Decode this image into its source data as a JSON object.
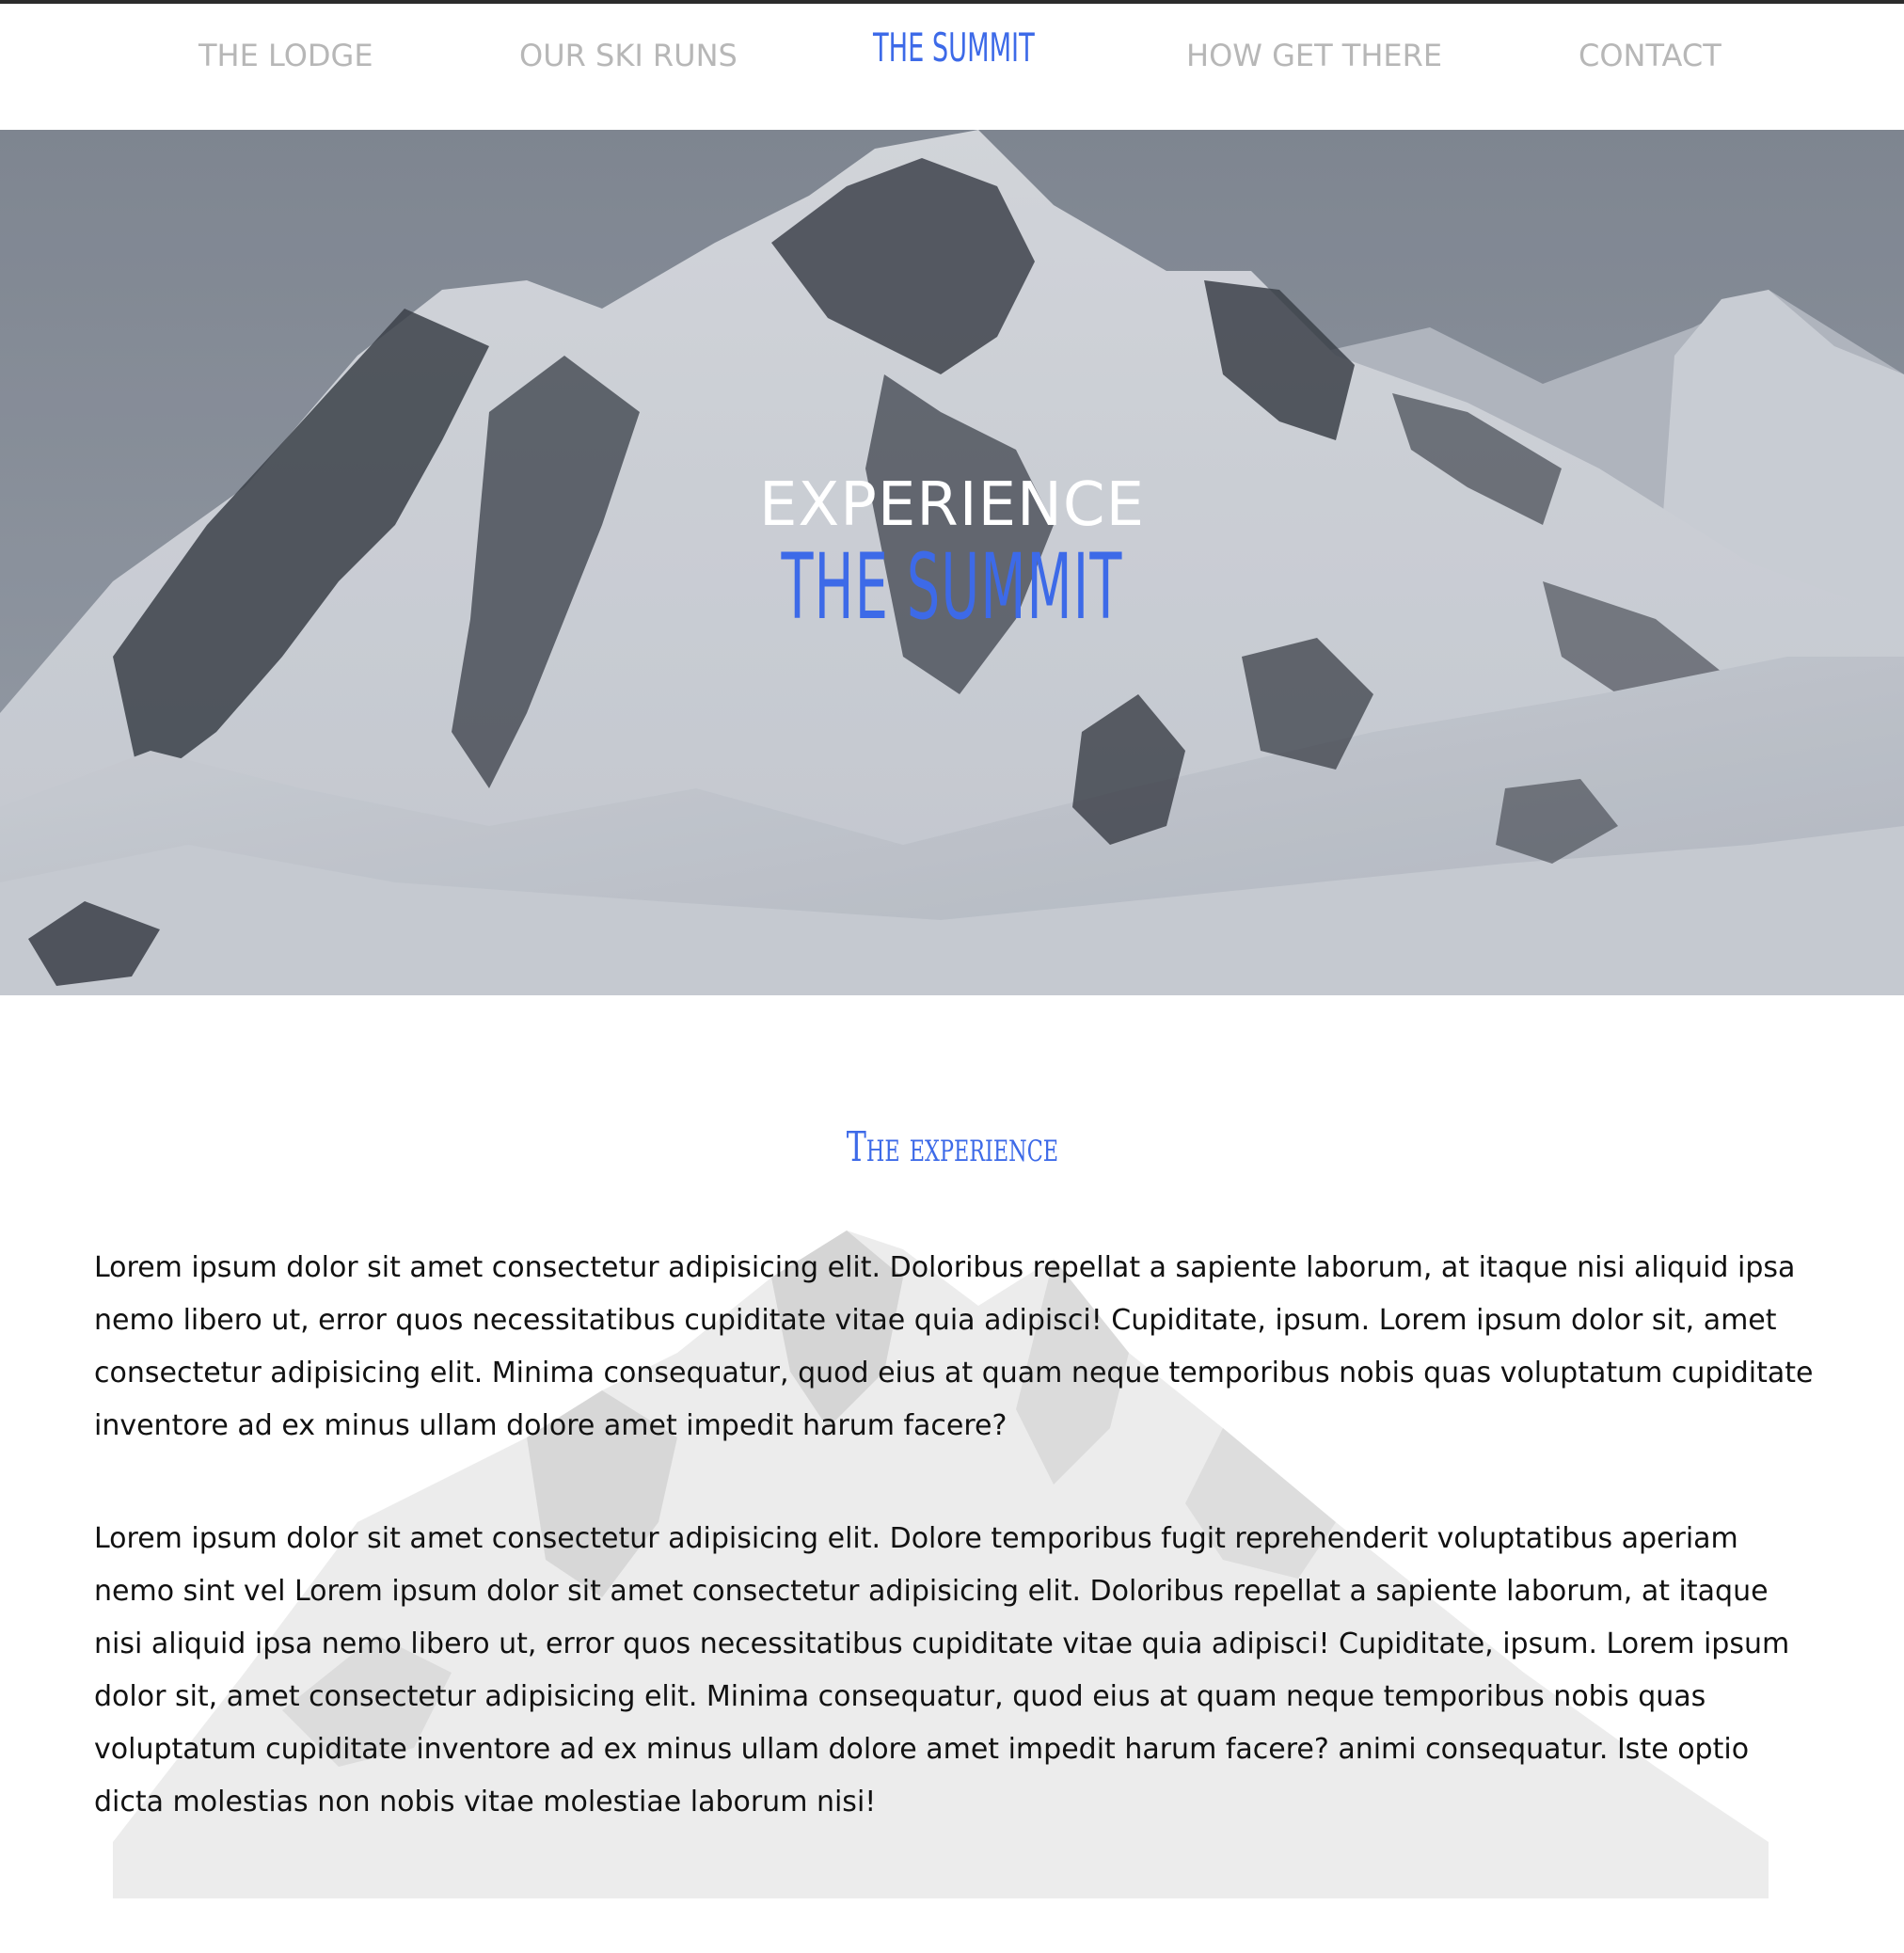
{
  "nav": {
    "items": [
      {
        "label": "THE LODGE",
        "active": false
      },
      {
        "label": "OUR SKI RUNS",
        "active": false
      },
      {
        "label": "THE SUMMIT",
        "active": true
      },
      {
        "label": "HOW GET THERE",
        "active": false
      },
      {
        "label": "CONTACT",
        "active": false
      }
    ]
  },
  "hero": {
    "title_line1": "EXPERIENCE",
    "title_line2": "THE SUMMIT",
    "image": "snowy-mountain-photo"
  },
  "section": {
    "title": "The experience",
    "paragraphs": [
      "Lorem ipsum dolor sit amet consectetur adipisicing elit. Doloribus repellat a sapiente laborum, at itaque nisi aliquid ipsa nemo libero ut, error quos necessitatibus cupiditate vitae quia adipisci! Cupiditate, ipsum. Lorem ipsum dolor sit, amet consectetur adipisicing elit. Minima consequatur, quod eius at quam neque temporibus nobis quas voluptatum cupiditate inventore ad ex minus ullam dolore amet impedit harum facere?",
      "Lorem ipsum dolor sit amet consectetur adipisicing elit. Dolore temporibus fugit reprehenderit voluptatibus aperiam nemo sint vel Lorem ipsum dolor sit amet consectetur adipisicing elit. Doloribus repellat a sapiente laborum, at itaque nisi aliquid ipsa nemo libero ut, error quos necessitatibus cupiditate vitae quia adipisci! Cupiditate, ipsum. Lorem ipsum dolor sit, amet consectetur adipisicing elit. Minima consequatur, quod eius at quam neque temporibus nobis quas voluptatum cupiditate inventore ad ex minus ullam dolore amet impedit harum facere? animi consequatur. Iste optio dicta molestias non nobis vitae molestiae laborum nisi!"
    ]
  },
  "colors": {
    "accent": "#3d6ae8",
    "nav_text": "#b7b7b7",
    "body_text": "#111111",
    "top_border": "#2b2b2b"
  }
}
